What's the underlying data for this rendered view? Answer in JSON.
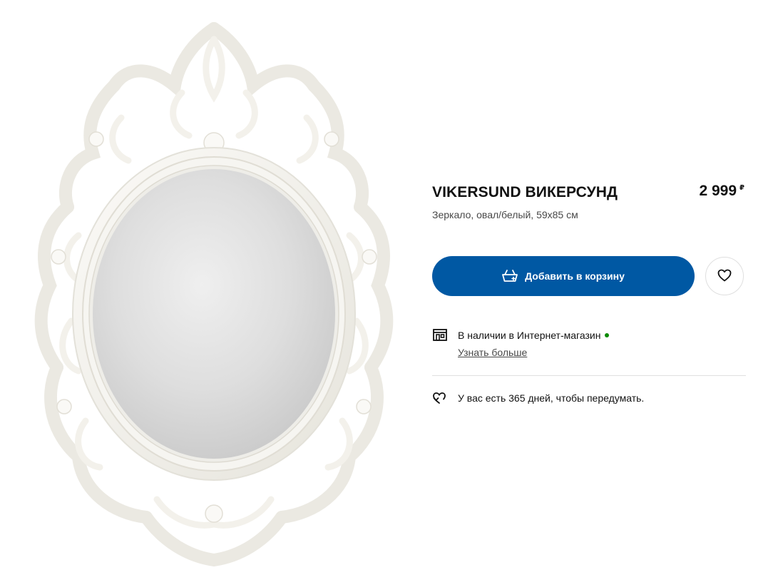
{
  "product": {
    "name": "VIKERSUND ВИКЕРСУНД",
    "description": "Зеркало, овал/белый, 59x85 см",
    "price": "2 999",
    "currency": "₽"
  },
  "actions": {
    "add_to_cart_label": "Добавить в корзину",
    "cart_icon": "cart-add-icon",
    "favourite_icon": "heart-icon"
  },
  "availability": {
    "text": "В наличии в Интернет-магазин",
    "status_color": "#0a8a00",
    "learn_more": "Узнать больше",
    "icon": "store-icon"
  },
  "returns": {
    "text": "У вас есть 365 дней, чтобы передумать.",
    "icon": "return-heart-icon"
  },
  "colors": {
    "accent": "#0058a3",
    "frame": "#f4f3ef",
    "mirror": "#d9d9d9"
  }
}
